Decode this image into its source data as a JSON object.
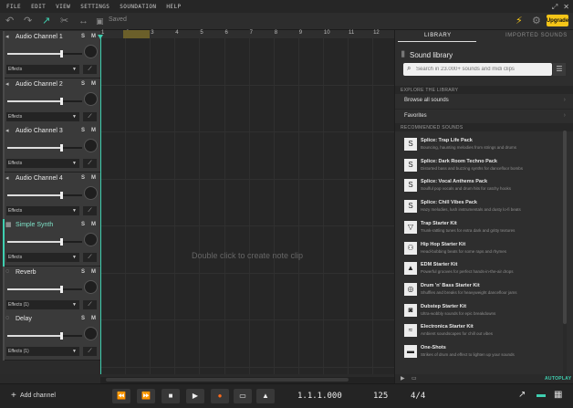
{
  "menu": [
    "FILE",
    "EDIT",
    "VIEW",
    "SETTINGS",
    "SOUNDATION",
    "HELP"
  ],
  "toolbar": {
    "saved_label": "Saved",
    "upgrade_label": "Upgrade"
  },
  "accent_color": "#3fcfb0",
  "upgrade_color": "#f5c518",
  "ruler": {
    "numbers": [
      "1",
      "2",
      "3",
      "4",
      "5",
      "6",
      "7",
      "8",
      "9",
      "10",
      "11",
      "12"
    ]
  },
  "tracks": [
    {
      "name": "Audio Channel 1",
      "solo": "S",
      "mute": "M",
      "effects": "Effects",
      "icon": "speaker-icon",
      "volume": 0.72
    },
    {
      "name": "Audio Channel 2",
      "solo": "S",
      "mute": "M",
      "effects": "Effects",
      "icon": "speaker-icon",
      "volume": 0.72
    },
    {
      "name": "Audio Channel 3",
      "solo": "S",
      "mute": "M",
      "effects": "Effects",
      "icon": "speaker-icon",
      "volume": 0.72
    },
    {
      "name": "Audio Channel 4",
      "solo": "S",
      "mute": "M",
      "effects": "Effects",
      "icon": "speaker-icon",
      "volume": 0.72
    },
    {
      "name": "Simple Synth",
      "solo": "S",
      "mute": "M",
      "effects": "Effects",
      "icon": "synth-icon",
      "volume": 0.72
    },
    {
      "name": "Reverb",
      "solo": "S",
      "mute": "M",
      "effects": "Effects (1)",
      "icon": "reverb-icon",
      "volume": 0.72
    },
    {
      "name": "Delay",
      "solo": "S",
      "mute": "M",
      "effects": "Effects (1)",
      "icon": "delay-icon",
      "volume": 0.72
    }
  ],
  "add_channel_label": "Add channel",
  "arrangement_hint": "Double click to create note clip",
  "library": {
    "tab_library": "LIBRARY",
    "tab_imported": "IMPORTED SOUNDS",
    "title": "Sound library",
    "search_placeholder": "Search in 23.000+ sounds and midi clips",
    "explore_header": "EXPLORE THE LIBRARY",
    "explore_items": [
      "Browse all sounds",
      "Favorites"
    ],
    "recommended_header": "RECOMMENDED SOUNDS",
    "packs": [
      {
        "name": "Splice: Trap Life Pack",
        "desc": "Bouncing, haunting melodies from strings and drums",
        "icon": "splice-icon"
      },
      {
        "name": "Splice: Dark Room Techno Pack",
        "desc": "Distorted bass and buzzing synths for dancefloor bombs",
        "icon": "splice-icon"
      },
      {
        "name": "Splice: Vocal Anthems Pack",
        "desc": "Soulful pop vocals and drum hits for catchy hooks",
        "icon": "splice-icon"
      },
      {
        "name": "Splice: Chill Vibes Pack",
        "desc": "Hazy melodies, lush instrumentals and dusty lo-fi beats",
        "icon": "splice-icon"
      },
      {
        "name": "Trap Starter Kit",
        "desc": "Trunk-rattling tunes for extra dark and gritty textures",
        "icon": "trap-icon"
      },
      {
        "name": "Hip Hop Starter Kit",
        "desc": "Head-bobbing beats for some raps and rhymes",
        "icon": "hiphop-icon"
      },
      {
        "name": "EDM Starter Kit",
        "desc": "Powerful grooves for perfect hands-in-the-air drops",
        "icon": "edm-icon"
      },
      {
        "name": "Drum 'n' Bass Starter Kit",
        "desc": "Shuffles and breaks for heavyweight dancefloor jams",
        "icon": "dnb-icon"
      },
      {
        "name": "Dubstep Starter Kit",
        "desc": "Ultra-wobbly sounds for epic breakdowns",
        "icon": "dubstep-icon"
      },
      {
        "name": "Electronica Starter Kit",
        "desc": "Ambient soundscapes for chill out vibes",
        "icon": "electronica-icon"
      },
      {
        "name": "One-Shots",
        "desc": "Strikes of drum and effect to lighten up your sounds",
        "icon": "oneshots-icon"
      }
    ],
    "autoplay_label": "AUTOPLAY"
  },
  "transport": {
    "position": "1.1.1.000",
    "bpm": "125",
    "time_signature": "4/4"
  }
}
